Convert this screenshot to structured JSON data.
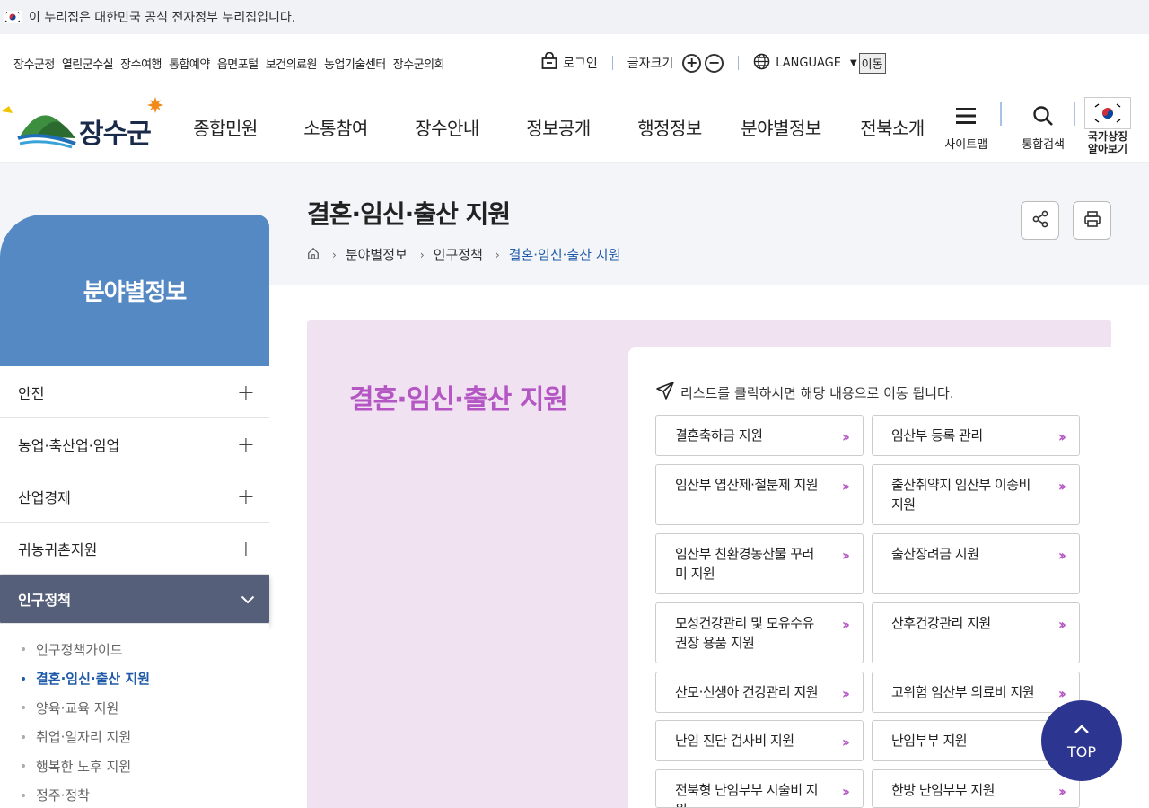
{
  "gov_banner": {
    "text": "이 누리집은 대한민국 공식 전자정부 누리집입니다."
  },
  "util": {
    "links": [
      "장수군청",
      "열린군수실",
      "장수여행",
      "통합예약",
      "읍면포털",
      "보건의료원",
      "농업기술센터",
      "장수군의회"
    ],
    "login": "로그인",
    "font_size": "글자크기",
    "language": "LANGUAGE",
    "go": "이동"
  },
  "header": {
    "logo_text": "장수군",
    "gnb": [
      "종합민원",
      "소통참여",
      "장수안내",
      "정보공개",
      "행정정보",
      "분야별정보",
      "전북소개"
    ],
    "sitemap": "사이트맵",
    "search": "통합검색",
    "symbol_line1": "국가상징",
    "symbol_line2": "알아보기"
  },
  "page": {
    "title": "결혼·임신·출산 지원",
    "breadcrumb": [
      "분야별정보",
      "인구정책",
      "결혼·임신·출산 지원"
    ]
  },
  "lnb": {
    "title": "분야별정보",
    "items": [
      {
        "label": "안전"
      },
      {
        "label": "농업·축산업·임업"
      },
      {
        "label": "산업경제"
      },
      {
        "label": "귀농귀촌지원"
      }
    ],
    "active": "인구정책",
    "sub_items": [
      {
        "label": "인구정책가이드"
      },
      {
        "label": "결혼·임신·출산 지원"
      },
      {
        "label": "양육·교육 지원"
      },
      {
        "label": "취업·일자리 지원"
      },
      {
        "label": "행복한 노후 지원"
      },
      {
        "label": "정주·정착"
      }
    ]
  },
  "content": {
    "title": "결혼·임신·출산 지원",
    "guide": "리스트를 클릭하시면 해당 내용으로 이동 됩니다.",
    "buttons": [
      "결혼축하금 지원",
      "임산부 등록 관리",
      "임산부 엽산제·철분제 지원",
      "출산취약지 임산부 이송비 지원",
      "임산부 친환경농산물 꾸러미 지원",
      "출산장려금 지원",
      "모성건강관리 및 모유수유 권장 용품 지원",
      "산후건강관리 지원",
      "산모·신생아 건강관리 지원",
      "고위험 임산부 의료비 지원",
      "난임 진단 검사비 지원",
      "난임부부 지원",
      "전북형 난임부부 시술비 지원",
      "한방 난임부부 지원"
    ]
  },
  "top_button": {
    "label": "TOP"
  },
  "colors": {
    "accent": "#b456c3",
    "nav_blue": "#5589c4",
    "active_nav": "#565f7a",
    "top_btn": "#2c3691",
    "link_blue": "#1f5aa8"
  }
}
